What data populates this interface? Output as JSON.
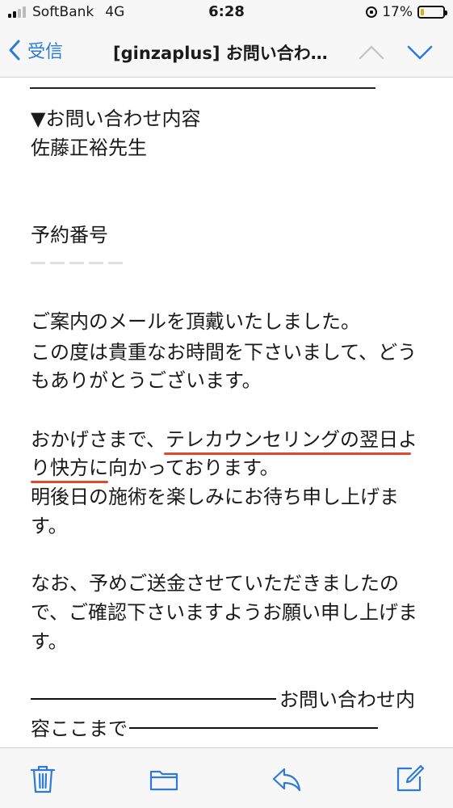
{
  "status_bar": {
    "carrier": "SoftBank",
    "network": "4G",
    "time": "6:28",
    "battery_percent": "17%",
    "battery_level": 0.17,
    "battery_color": "#e9a816"
  },
  "nav": {
    "back_label": "受信",
    "title": "[ginzaplus] お問い合わ…",
    "accent_color": "#2d7bd6",
    "icons": [
      "chevron-left-icon",
      "chevron-up-icon",
      "chevron-down-icon"
    ]
  },
  "email": {
    "lines": [
      "▼お問い合わせ内容",
      "佐藤正裕先生",
      "予約番号",
      "ご案内のメールを頂戴いたしました。",
      "この度は貴重なお時間を下さいまして、どう",
      "もありがとうございます。",
      "おかげさまで、テレカウンセリングの翌日よ",
      "り快方に向かっております。",
      "明後日の施術を楽しみにお待ち申し上げま",
      "す。",
      "なお、予めご送金させていただきましたの",
      "で、ご確認下さいますようお願い申し上げま",
      "す。",
      "お問い合わせ内",
      "容ここまで"
    ],
    "highlight_color": "#e04a2a"
  },
  "toolbar": {
    "icons": [
      "trash-icon",
      "folder-icon",
      "reply-icon",
      "compose-icon"
    ],
    "icon_color": "#2d7bd6"
  }
}
